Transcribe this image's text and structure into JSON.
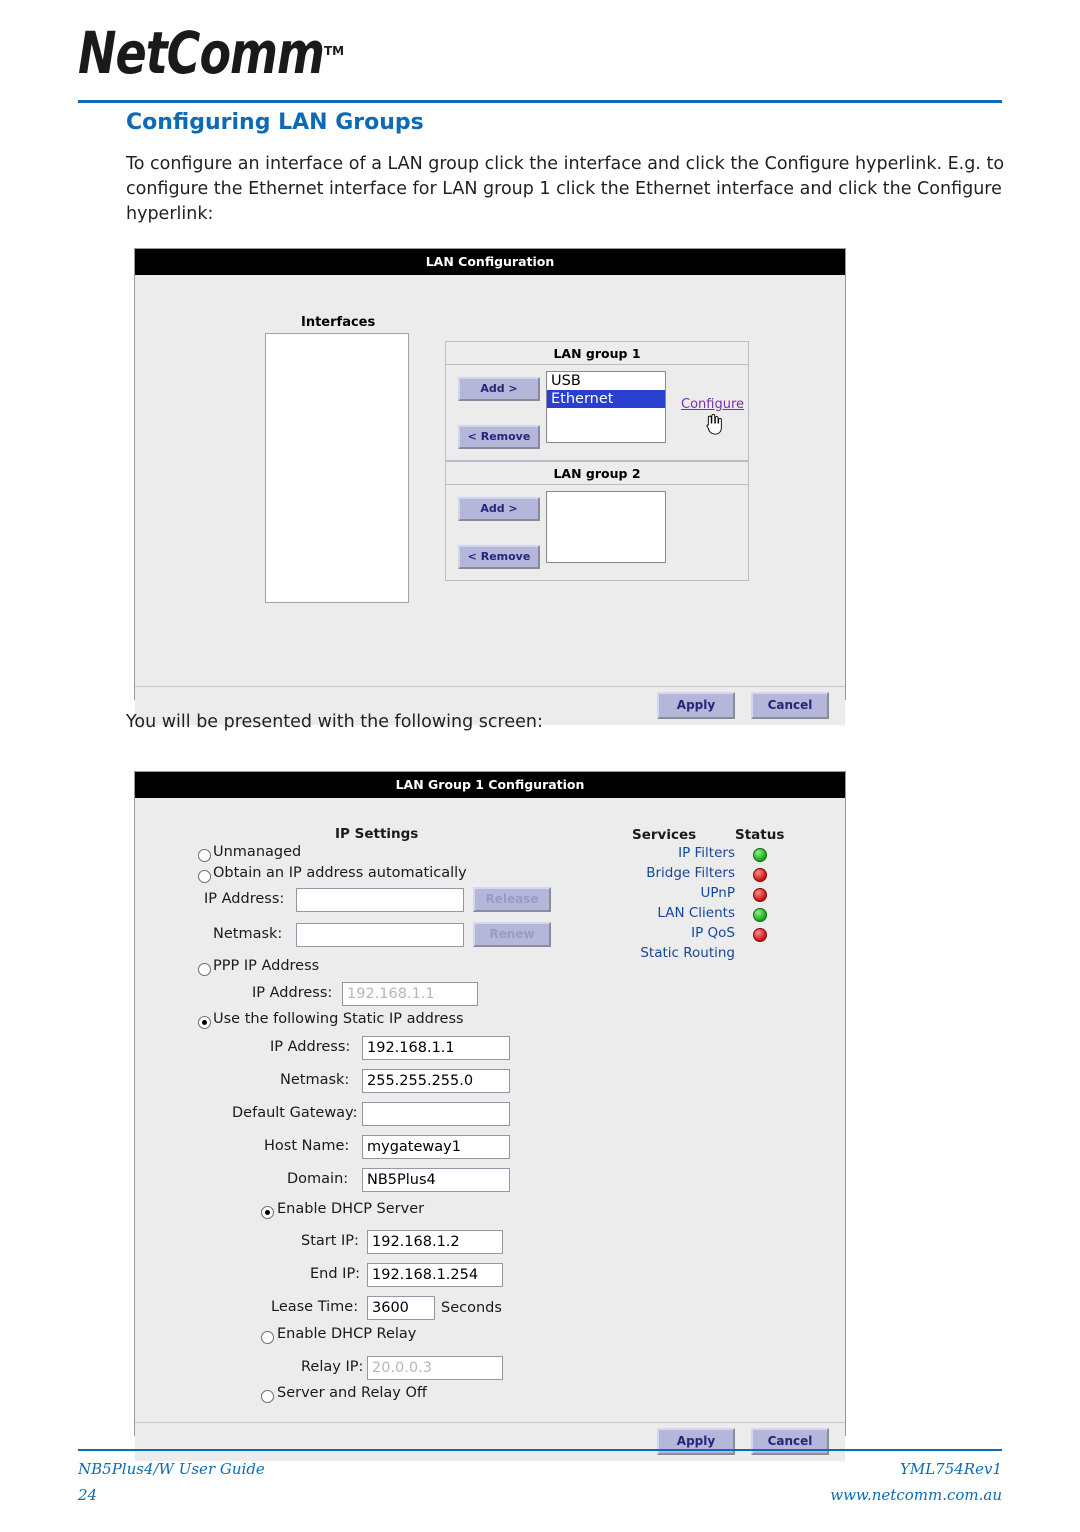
{
  "brand": {
    "name": "NetComm",
    "tm": "TM"
  },
  "title": "Configuring LAN Groups",
  "paragraphs": {
    "p1": "To configure an interface of a LAN group click the interface and click the Configure hyperlink. E.g. to configure the Ethernet interface for LAN group 1 click the Ethernet interface and click the Configure hyperlink:",
    "p2": "You will be presented with the following screen:"
  },
  "screen1": {
    "title": "LAN Configuration",
    "interfaces_label": "Interfaces",
    "group1": {
      "heading": "LAN group 1",
      "add_label": "Add >",
      "remove_label": "< Remove",
      "items": [
        {
          "label": "USB",
          "selected": false
        },
        {
          "label": "Ethernet",
          "selected": true
        }
      ],
      "configure_link": "Configure"
    },
    "group2": {
      "heading": "LAN group 2",
      "add_label": "Add >",
      "remove_label": "< Remove",
      "items": []
    },
    "apply_label": "Apply",
    "cancel_label": "Cancel"
  },
  "screen2": {
    "title": "LAN Group 1 Configuration",
    "ip_settings_heading": "IP Settings",
    "services_heading": "Services",
    "status_heading": "Status",
    "options": {
      "unmanaged": "Unmanaged",
      "obtain_auto": "Obtain an IP address automatically",
      "ppp_ip": "PPP IP Address",
      "static_ip": "Use the following Static IP address",
      "enable_dhcp_server": "Enable DHCP Server",
      "enable_dhcp_relay": "Enable DHCP Relay",
      "server_relay_off": "Server and Relay Off"
    },
    "fields": {
      "ip_address_label": "IP Address:",
      "netmask_label": "Netmask:",
      "default_gateway_label": "Default Gateway:",
      "host_name_label": "Host Name:",
      "domain_label": "Domain:",
      "start_ip_label": "Start IP:",
      "end_ip_label": "End IP:",
      "lease_time_label": "Lease Time:",
      "relay_ip_label": "Relay IP:",
      "seconds_label": "Seconds",
      "auto_ip_value": "",
      "auto_netmask_value": "",
      "ppp_ip_value": "192.168.1.1",
      "static_ip_value": "192.168.1.1",
      "static_netmask_value": "255.255.255.0",
      "default_gateway_value": "",
      "host_name_value": "mygateway1",
      "domain_value": "NB5Plus4",
      "start_ip_value": "192.168.1.2",
      "end_ip_value": "192.168.1.254",
      "lease_time_value": "3600",
      "relay_ip_value": "20.0.0.3"
    },
    "buttons": {
      "release": "Release",
      "renew": "Renew",
      "apply": "Apply",
      "cancel": "Cancel"
    },
    "services": [
      {
        "name": "IP Filters",
        "status": "green"
      },
      {
        "name": "Bridge Filters",
        "status": "red"
      },
      {
        "name": "UPnP",
        "status": "red"
      },
      {
        "name": "LAN Clients",
        "status": "green"
      },
      {
        "name": "IP QoS",
        "status": "red"
      },
      {
        "name": "Static Routing",
        "status": "none"
      }
    ]
  },
  "footer": {
    "left": "NB5Plus4/W User Guide",
    "page": "24",
    "right_top": "YML754Rev1",
    "right_bottom": "www.netcomm.com.au"
  },
  "colors": {
    "accent": "#0d6ab5",
    "link": "#14489c",
    "selected": "#2a3fd0"
  }
}
